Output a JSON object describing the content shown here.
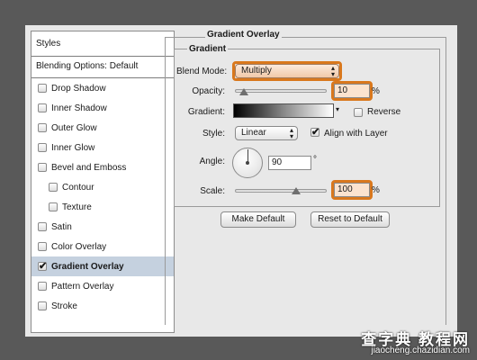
{
  "styles_panel": {
    "header": "Styles",
    "blending_options": "Blending Options: Default",
    "items": [
      {
        "label": "Drop Shadow",
        "checked": false,
        "sub": false
      },
      {
        "label": "Inner Shadow",
        "checked": false,
        "sub": false
      },
      {
        "label": "Outer Glow",
        "checked": false,
        "sub": false
      },
      {
        "label": "Inner Glow",
        "checked": false,
        "sub": false
      },
      {
        "label": "Bevel and Emboss",
        "checked": false,
        "sub": false
      },
      {
        "label": "Contour",
        "checked": false,
        "sub": true
      },
      {
        "label": "Texture",
        "checked": false,
        "sub": true
      },
      {
        "label": "Satin",
        "checked": false,
        "sub": false
      },
      {
        "label": "Color Overlay",
        "checked": false,
        "sub": false
      },
      {
        "label": "Gradient Overlay",
        "checked": true,
        "sub": false
      },
      {
        "label": "Pattern Overlay",
        "checked": false,
        "sub": false
      },
      {
        "label": "Stroke",
        "checked": false,
        "sub": false
      }
    ]
  },
  "panel": {
    "title": "Gradient Overlay",
    "group": "Gradient",
    "blend_mode_label": "Blend Mode:",
    "blend_mode_value": "Multiply",
    "opacity_label": "Opacity:",
    "opacity_value": "10",
    "opacity_fraction": 0.1,
    "percent": "%",
    "gradient_label": "Gradient:",
    "reverse_label": "Reverse",
    "reverse_checked": false,
    "style_label": "Style:",
    "style_value": "Linear",
    "align_label": "Align with Layer",
    "align_checked": true,
    "angle_label": "Angle:",
    "angle_value": "90",
    "degree": "°",
    "scale_label": "Scale:",
    "scale_value": "100",
    "scale_fraction": 0.67,
    "make_default": "Make Default",
    "reset_default": "Reset to Default"
  },
  "watermark": {
    "line1": "查字典 教程网",
    "line2": "jiaocheng.chazidian.com"
  },
  "colors": {
    "highlight": "#d9781d",
    "selected_row": "#c5d1df"
  }
}
